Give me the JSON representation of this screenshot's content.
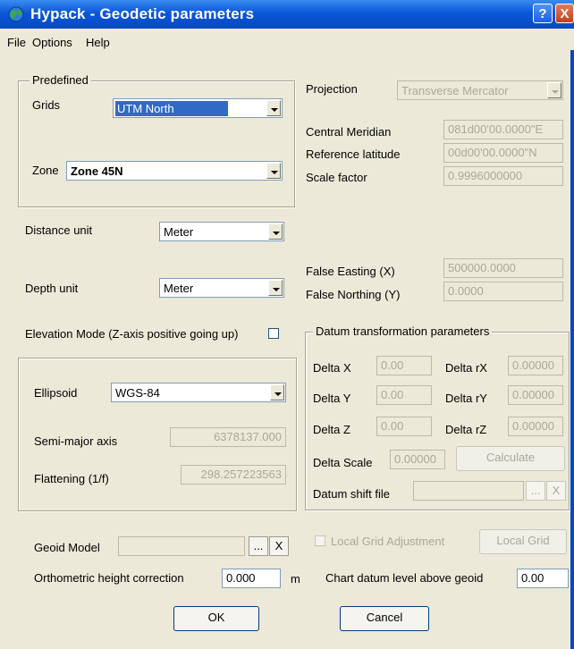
{
  "window": {
    "title": "Hypack - Geodetic parameters",
    "help_label": "?",
    "close_label": "X"
  },
  "menu": {
    "items": [
      "File",
      "Options",
      "Help"
    ]
  },
  "predefined": {
    "legend": "Predefined",
    "grids_label": "Grids",
    "grids_value": "UTM North",
    "zone_label": "Zone",
    "zone_value": "Zone 45N"
  },
  "distance_unit": {
    "label": "Distance unit",
    "value": "Meter"
  },
  "depth_unit": {
    "label": "Depth unit",
    "value": "Meter"
  },
  "elevation_mode": {
    "label": "Elevation Mode (Z-axis positive going up)",
    "checked": false
  },
  "ellipsoid_group": {
    "ellipsoid_label": "Ellipsoid",
    "ellipsoid_value": "WGS-84",
    "semi_major_label": "Semi-major axis",
    "semi_major_value": "6378137.000",
    "flattening_label": "Flattening (1/f)",
    "flattening_value": "298.257223563"
  },
  "projection": {
    "label": "Projection",
    "value": "Transverse Mercator",
    "central_meridian_label": "Central Meridian",
    "central_meridian_value": "081d00'00.0000\"E",
    "reference_latitude_label": "Reference latitude",
    "reference_latitude_value": "00d00'00.0000\"N",
    "scale_factor_label": "Scale factor",
    "scale_factor_value": "0.9996000000",
    "false_easting_label": "False Easting (X)",
    "false_easting_value": "500000.0000",
    "false_northing_label": "False Northing (Y)",
    "false_northing_value": "0.0000"
  },
  "datum": {
    "legend": "Datum transformation parameters",
    "delta_x_label": "Delta X",
    "delta_x_value": "0.00",
    "delta_y_label": "Delta Y",
    "delta_y_value": "0.00",
    "delta_z_label": "Delta Z",
    "delta_z_value": "0.00",
    "delta_rx_label": "Delta rX",
    "delta_rx_value": "0.00000",
    "delta_ry_label": "Delta rY",
    "delta_ry_value": "0.00000",
    "delta_rz_label": "Delta rZ",
    "delta_rz_value": "0.00000",
    "delta_scale_label": "Delta Scale",
    "delta_scale_value": "0.00000",
    "calculate_label": "Calculate",
    "shift_file_label": "Datum shift file",
    "browse_label": "...",
    "clear_label": "X"
  },
  "geoid": {
    "label": "Geoid Model",
    "value": "",
    "browse_label": "...",
    "clear_label": "X"
  },
  "local_grid": {
    "adjustment_label": "Local Grid Adjustment",
    "button_label": "Local Grid"
  },
  "orthometric": {
    "label": "Orthometric height correction",
    "value": "0.000",
    "unit": "m"
  },
  "chart_datum": {
    "label": "Chart datum level above geoid",
    "value": "0.00"
  },
  "buttons": {
    "ok": "OK",
    "cancel": "Cancel"
  }
}
